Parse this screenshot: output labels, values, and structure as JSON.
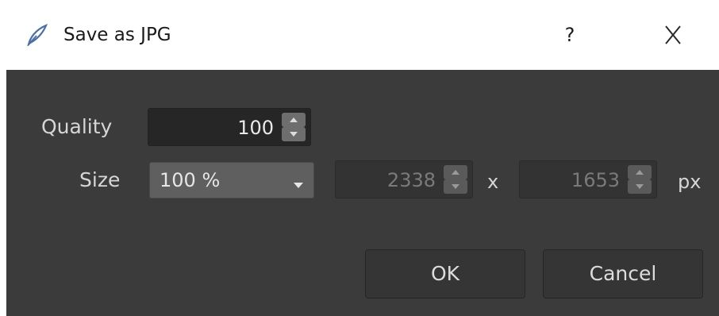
{
  "window": {
    "title": "Save as JPG",
    "help_label": "?",
    "icons": {
      "app": "quill-pen-icon",
      "close": "close-icon"
    }
  },
  "form": {
    "quality_label": "Quality",
    "quality_value": "100",
    "size_label": "Size",
    "size_selected": "100 %",
    "width_value": "2338",
    "times_label": "x",
    "height_value": "1653",
    "unit_label": "px"
  },
  "buttons": {
    "ok_label": "OK",
    "cancel_label": "Cancel"
  },
  "colors": {
    "background": "#3b3b3b",
    "titlebar": "#ffffff",
    "field": "#262626",
    "dropdown": "#5f5f5f"
  }
}
